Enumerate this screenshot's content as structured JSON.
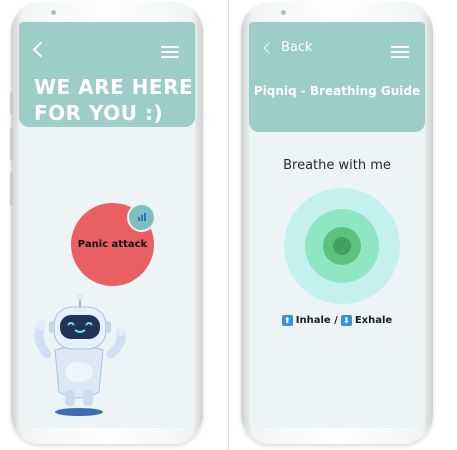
{
  "left_screen": {
    "hero_title": "WE ARE HERE FOR YOU :)",
    "panic_button_label": "Panic attack"
  },
  "right_screen": {
    "back_label": "Back",
    "title": "Piqniq - Breathing Guide",
    "prompt": "Breathe with me",
    "inhale_label": "Inhale /",
    "exhale_label": "Exhale",
    "up_arrow": "⬆",
    "down_arrow": "⬇"
  },
  "colors": {
    "header": "#9ccdc7",
    "panic": "#e86061",
    "screen_bg": "#edf4f6"
  }
}
